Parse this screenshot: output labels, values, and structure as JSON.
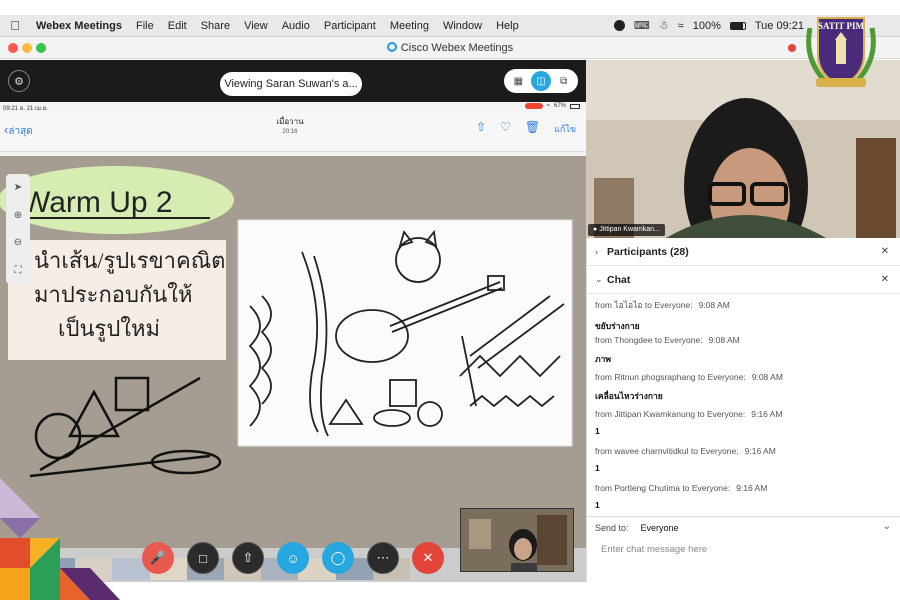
{
  "menubar": {
    "app_name": "Webex Meetings",
    "items": [
      "File",
      "Edit",
      "Share",
      "View",
      "Audio",
      "Participant",
      "Meeting",
      "Window",
      "Help"
    ],
    "battery": "100%",
    "clock": "Tue 09:21"
  },
  "window": {
    "title": "Cisco Webex Meetings"
  },
  "share": {
    "viewing_label": "Viewing Saran Suwan's a...",
    "ipad": {
      "status_time": "09:21 อ. 21 เม.ย.",
      "status_battery": "67%",
      "back_label": "ล่าสุด",
      "note_title": "เมื่อวาน",
      "note_time": "20:16",
      "edit_label": "แก้ไข"
    },
    "whiteboard": {
      "heading": "Warm Up 2",
      "instruction_lines": [
        "นำเส้น/รูปเรขาคณิต",
        "มาประกอบกันให้",
        "เป็นรูปใหม่"
      ]
    }
  },
  "video": {
    "participant_name": "Jittipan Kwamkan..."
  },
  "seal": {
    "text": "SATIT PIM"
  },
  "panel": {
    "participants_label": "Participants (28)",
    "chat_label": "Chat",
    "messages": [
      {
        "sender": "from ไอไอไอ to Everyone:",
        "time": "9:08  AM",
        "text": "ขยับร่างกาย"
      },
      {
        "sender": "from Thongdee to Everyone:",
        "time": "9:08  AM",
        "text": "ภาพ"
      },
      {
        "sender": "from Ritnun phogsraphang to Everyone:",
        "time": "9:08  AM",
        "text": "เคลื่อนไหวร่างกาย"
      },
      {
        "sender": "from Jittipan Kwamkanung to Everyone:",
        "time": "9:16  AM",
        "text": "1"
      },
      {
        "sender": "from wavee charnvitidkul to Everyone:",
        "time": "9:16  AM",
        "text": "1"
      },
      {
        "sender": "from Portleng Chutima to Everyone:",
        "time": "9:16  AM",
        "text": "1"
      }
    ],
    "send_to_label": "Send to:",
    "send_to_value": "Everyone",
    "chat_placeholder": "Enter chat message here"
  },
  "colors": {
    "accent": "#27a7e0",
    "end_red": "#e4453a",
    "mute_red": "#e85a50"
  }
}
